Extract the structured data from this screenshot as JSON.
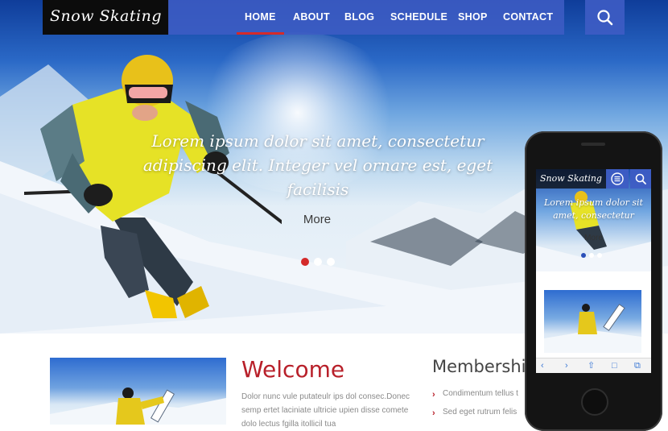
{
  "header": {
    "logo": "Snow Skating",
    "nav": [
      {
        "label": "HOME",
        "active": true
      },
      {
        "label": "ABOUT",
        "active": false
      },
      {
        "label": "BLOG",
        "active": false
      },
      {
        "label": "SCHEDULE",
        "active": false
      },
      {
        "label": "SHOP",
        "active": false
      },
      {
        "label": "CONTACT",
        "active": false
      }
    ],
    "search_icon": "search-icon"
  },
  "banner": {
    "text": "Lorem ipsum dolor sit amet, consectetur adipiscing elit. Integer vel ornare est, eget facilisis",
    "more_label": "More",
    "slides": 3,
    "active_slide": 1
  },
  "welcome": {
    "title": "Welcome",
    "text": "Dolor nunc vule putateulr ips dol consec.Donec semp ertet laciniate ultricie upien disse comete dolo lectus fgilla itollicil tua"
  },
  "membership": {
    "title": "Membership",
    "items": [
      "Condimentum tellus t",
      "Sed eget rutrum felis"
    ]
  },
  "phone": {
    "logo": "Snow Skating",
    "banner_text": "Lorem ipsum dolor sit amet, consectetur",
    "more_label": "More"
  },
  "colors": {
    "nav_bg": "#3e5cc4",
    "accent": "#d42a2a",
    "welcome_title": "#b8202a",
    "logo_bg": "#0c0c0c"
  }
}
